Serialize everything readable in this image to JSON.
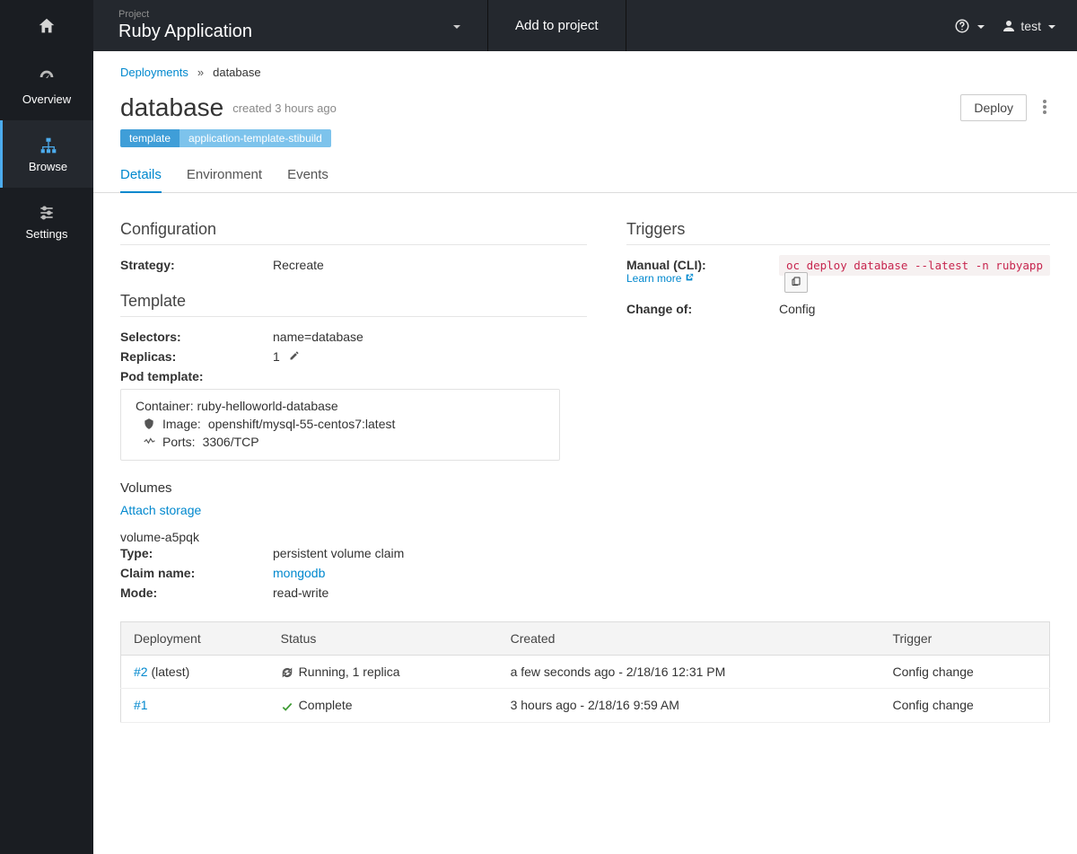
{
  "topbar": {
    "project_eyebrow": "Project",
    "project_name": "Ruby Application",
    "add_to_project": "Add to project",
    "username": "test"
  },
  "sidebar": {
    "overview": "Overview",
    "browse": "Browse",
    "settings": "Settings"
  },
  "crumbs": {
    "root": "Deployments",
    "sep": "»",
    "current": "database"
  },
  "header": {
    "title": "database",
    "meta": "created 3 hours ago",
    "deploy": "Deploy"
  },
  "badges": {
    "key": "template",
    "value": "application-template-stibuild"
  },
  "tabs": {
    "details": "Details",
    "environment": "Environment",
    "events": "Events"
  },
  "config": {
    "section": "Configuration",
    "strategy_label": "Strategy:",
    "strategy": "Recreate",
    "template_section": "Template",
    "selectors_label": "Selectors:",
    "selectors": "name=database",
    "replicas_label": "Replicas:",
    "replicas": "1",
    "pod_template_label": "Pod template:"
  },
  "pod": {
    "container_label": "Container:",
    "container": "ruby-helloworld-database",
    "image_label": "Image:",
    "image": "openshift/mysql-55-centos7:latest",
    "ports_label": "Ports:",
    "ports": "3306/TCP"
  },
  "volumes": {
    "section": "Volumes",
    "attach": "Attach storage",
    "name": "volume-a5pqk",
    "type_label": "Type:",
    "type": "persistent volume claim",
    "claim_label": "Claim name:",
    "claim": "mongodb",
    "mode_label": "Mode:",
    "mode": "read-write"
  },
  "triggers": {
    "section": "Triggers",
    "manual_label": "Manual (CLI):",
    "learn_more": "Learn more",
    "cli": "oc deploy database --latest -n rubyapp",
    "change_label": "Change of:",
    "change": "Config"
  },
  "table": {
    "h_deployment": "Deployment",
    "h_status": "Status",
    "h_created": "Created",
    "h_trigger": "Trigger",
    "rows": [
      {
        "id": "#2",
        "suffix": " (latest)",
        "status": "Running, 1 replica",
        "created": "a few seconds ago - 2/18/16 12:31 PM",
        "trigger": "Config change",
        "icon": "spin"
      },
      {
        "id": "#1",
        "suffix": "",
        "status": "Complete",
        "created": "3 hours ago - 2/18/16 9:59 AM",
        "trigger": "Config change",
        "icon": "check"
      }
    ]
  }
}
